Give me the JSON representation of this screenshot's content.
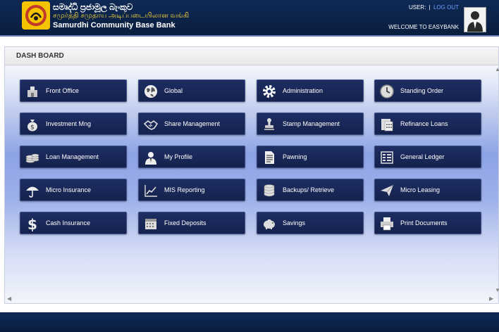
{
  "header": {
    "brand_si": "සමෘද්ධි ප්‍රජාමූල බැංකුව",
    "brand_ta": "சமுர்த்தி சமுதாய அடிப்படையிலான வங்கி",
    "brand_en": "Samurdhi Community Base Bank",
    "user_label": "USER:",
    "separator": "|",
    "logout_label": "LOG OUT",
    "welcome": "WELCOME TO EASYBANK"
  },
  "dashboard": {
    "title": "DASH BOARD",
    "tiles": [
      {
        "label": "Front Office",
        "icon": "building-icon"
      },
      {
        "label": "Global",
        "icon": "globe-icon"
      },
      {
        "label": "Administration",
        "icon": "gear-icon"
      },
      {
        "label": "Standing Order",
        "icon": "clock-icon"
      },
      {
        "label": "Investment Mng",
        "icon": "money-bag-icon"
      },
      {
        "label": "Share Management",
        "icon": "handshake-icon"
      },
      {
        "label": "Stamp Management",
        "icon": "stamp-icon"
      },
      {
        "label": "Refinance Loans",
        "icon": "calculator-icon"
      },
      {
        "label": "Loan Management",
        "icon": "coins-icon"
      },
      {
        "label": "My Profile",
        "icon": "user-icon"
      },
      {
        "label": "Pawning",
        "icon": "document-icon"
      },
      {
        "label": "General Ledger",
        "icon": "ledger-icon"
      },
      {
        "label": "Micro Insurance",
        "icon": "umbrella-icon"
      },
      {
        "label": "MIS Reporting",
        "icon": "chart-icon"
      },
      {
        "label": "Backups/ Retrieve",
        "icon": "database-icon"
      },
      {
        "label": "Micro Leasing",
        "icon": "paper-plane-icon"
      },
      {
        "label": "Cash Insurance",
        "icon": "dollar-icon"
      },
      {
        "label": "Fixed Deposits",
        "icon": "calendar-icon"
      },
      {
        "label": "Savings",
        "icon": "piggy-bank-icon"
      },
      {
        "label": "Print Documents",
        "icon": "printer-icon"
      }
    ]
  }
}
